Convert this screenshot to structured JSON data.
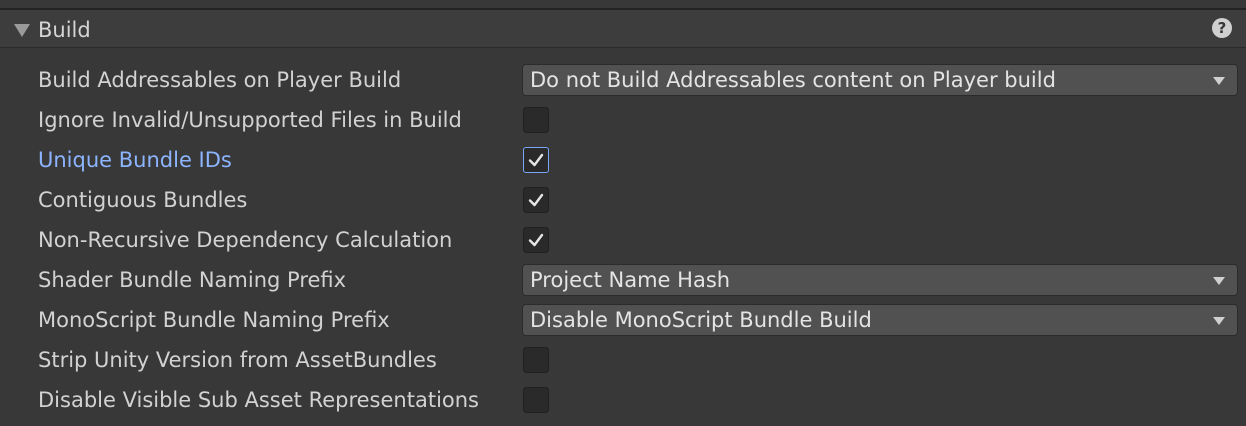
{
  "section": {
    "title": "Build",
    "help_glyph": "?"
  },
  "icons": {
    "foldout": "triangle-down-icon",
    "help": "question-mark-icon",
    "dropdown": "chevron-down-icon",
    "check": "checkmark-icon"
  },
  "colors": {
    "background": "#383838",
    "header": "#3d3d3d",
    "label": "#d2d2d2",
    "highlight_label": "#8cb4ff",
    "focus_border": "#7aa6f5"
  },
  "rows": [
    {
      "label": "Build Addressables on Player Build",
      "type": "dropdown",
      "value": "Do not Build Addressables content on Player build"
    },
    {
      "label": "Ignore Invalid/Unsupported Files in Build",
      "type": "checkbox",
      "checked": false
    },
    {
      "label": "Unique Bundle IDs",
      "type": "checkbox",
      "checked": true,
      "focused": true
    },
    {
      "label": "Contiguous Bundles",
      "type": "checkbox",
      "checked": true
    },
    {
      "label": "Non-Recursive Dependency Calculation",
      "type": "checkbox",
      "checked": true
    },
    {
      "label": "Shader Bundle Naming Prefix",
      "type": "dropdown",
      "value": "Project Name Hash"
    },
    {
      "label": "MonoScript Bundle Naming Prefix",
      "type": "dropdown",
      "value": "Disable MonoScript Bundle Build"
    },
    {
      "label": "Strip Unity Version from AssetBundles",
      "type": "checkbox",
      "checked": false
    },
    {
      "label": "Disable Visible Sub Asset Representations",
      "type": "checkbox",
      "checked": false
    }
  ]
}
